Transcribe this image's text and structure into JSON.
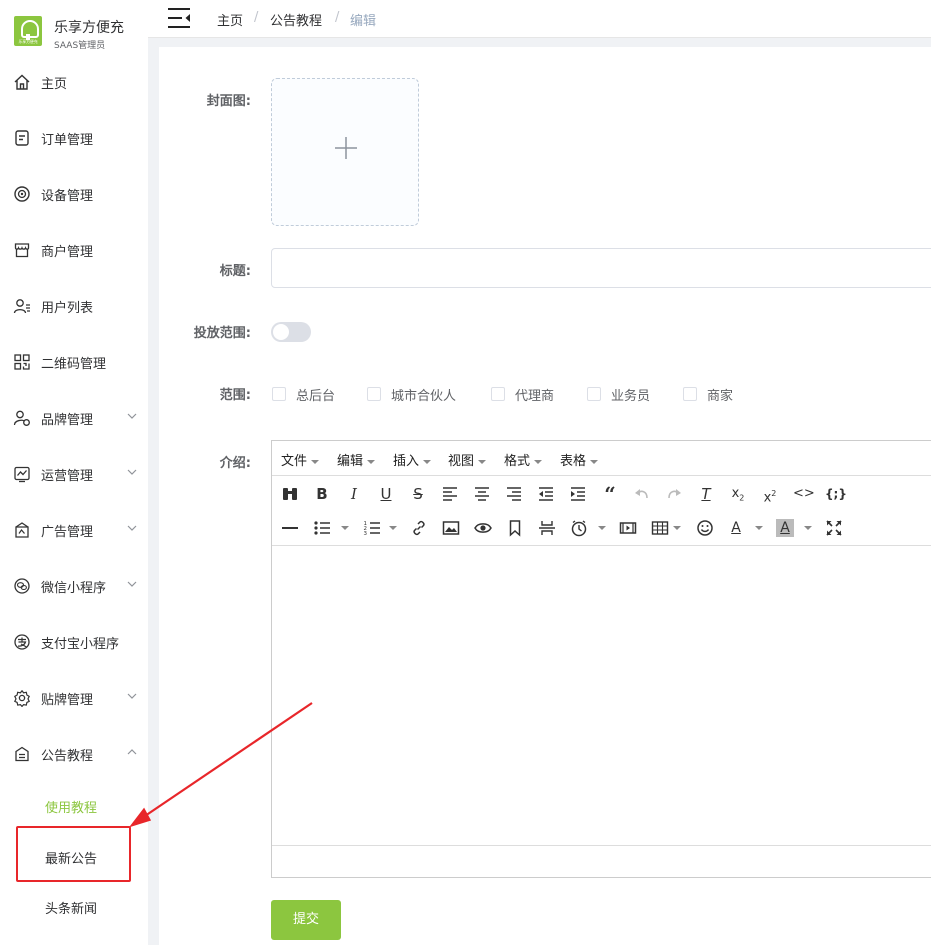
{
  "brand": {
    "name": "乐享方便充",
    "role": "SAAS管理员",
    "logo_text": "乐享方便充"
  },
  "sidebar": {
    "items": [
      {
        "label": "主页",
        "icon": "home-icon"
      },
      {
        "label": "订单管理",
        "icon": "order-icon"
      },
      {
        "label": "设备管理",
        "icon": "device-icon"
      },
      {
        "label": "商户管理",
        "icon": "store-icon"
      },
      {
        "label": "用户列表",
        "icon": "user-list-icon"
      },
      {
        "label": "二维码管理",
        "icon": "qrcode-icon"
      },
      {
        "label": "品牌管理",
        "icon": "brand-icon"
      },
      {
        "label": "运营管理",
        "icon": "operations-icon"
      },
      {
        "label": "广告管理",
        "icon": "ad-icon"
      },
      {
        "label": "微信小程序",
        "icon": "wechat-icon"
      },
      {
        "label": "支付宝小程序",
        "icon": "alipay-icon"
      },
      {
        "label": "贴牌管理",
        "icon": "settings-icon"
      },
      {
        "label": "公告教程",
        "icon": "notice-icon"
      }
    ],
    "sub_items": [
      {
        "label": "使用教程"
      },
      {
        "label": "最新公告"
      },
      {
        "label": "头条新闻"
      }
    ]
  },
  "breadcrumb": {
    "items": [
      "主页",
      "公告教程",
      "编辑"
    ],
    "separator": "/"
  },
  "form": {
    "cover_label": "封面图:",
    "title_label": "标题:",
    "title_value": "",
    "scope_toggle_label": "投放范围:",
    "scope_label": "范围:",
    "scope_options": [
      "总后台",
      "城市合伙人",
      "代理商",
      "业务员",
      "商家"
    ],
    "intro_label": "介绍:",
    "submit_label": "提交"
  },
  "editor": {
    "menus": [
      "文件",
      "编辑",
      "插入",
      "视图",
      "格式",
      "表格"
    ]
  },
  "colors": {
    "accent": "#8cc63f",
    "annotation": "#e8262a"
  }
}
